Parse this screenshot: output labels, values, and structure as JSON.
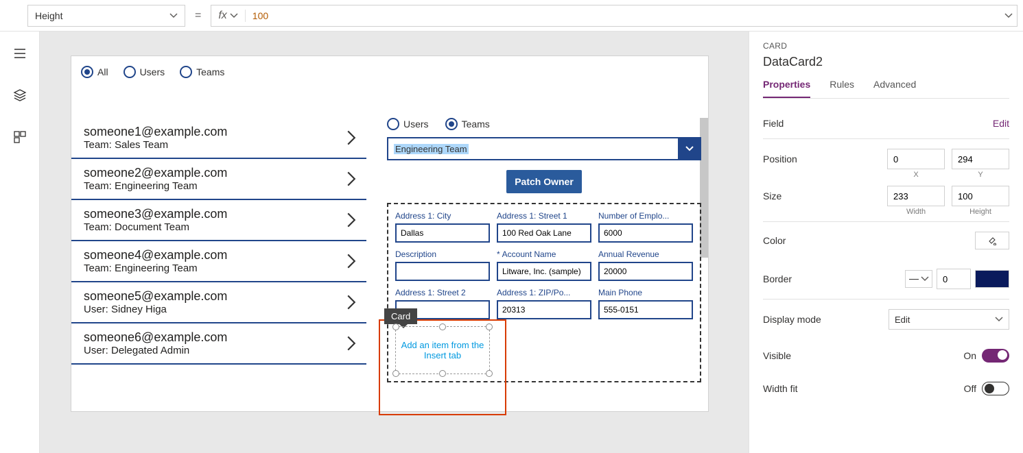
{
  "topbar": {
    "property": "Height",
    "eq": "=",
    "fx_label": "fx",
    "formula": "100"
  },
  "canvas": {
    "filter": {
      "options": [
        "All",
        "Users",
        "Teams"
      ],
      "selected": "All"
    },
    "list": [
      {
        "title": "someone1@example.com",
        "sub": "Team: Sales Team"
      },
      {
        "title": "someone2@example.com",
        "sub": "Team: Engineering Team"
      },
      {
        "title": "someone3@example.com",
        "sub": "Team: Document Team"
      },
      {
        "title": "someone4@example.com",
        "sub": "Team: Engineering Team"
      },
      {
        "title": "someone5@example.com",
        "sub": "User: Sidney Higa"
      },
      {
        "title": "someone6@example.com",
        "sub": "User: Delegated Admin"
      }
    ],
    "owner_filter": {
      "options": [
        "Users",
        "Teams"
      ],
      "selected": "Teams"
    },
    "combo_value": "Engineering Team",
    "patch_button": "Patch Owner",
    "fields": [
      {
        "label": "Address 1: City",
        "value": "Dallas",
        "required": false
      },
      {
        "label": "Address 1: Street 1",
        "value": "100 Red Oak Lane",
        "required": false
      },
      {
        "label": "Number of Emplo...",
        "value": "6000",
        "required": false
      },
      {
        "label": "Description",
        "value": "",
        "required": false
      },
      {
        "label": "Account Name",
        "value": "Litware, Inc. (sample)",
        "required": true
      },
      {
        "label": "Annual Revenue",
        "value": "20000",
        "required": false
      },
      {
        "label": "Address 1: Street 2",
        "value": "",
        "required": false
      },
      {
        "label": "Address 1: ZIP/Po...",
        "value": "20313",
        "required": false
      },
      {
        "label": "Main Phone",
        "value": "555-0151",
        "required": false
      }
    ],
    "selected_card_tag": "Card",
    "empty_card_hint": "Add an item from the Insert tab"
  },
  "panel": {
    "eyebrow": "CARD",
    "title": "DataCard2",
    "tabs": [
      "Properties",
      "Rules",
      "Advanced"
    ],
    "active_tab": "Properties",
    "field_label": "Field",
    "edit_link": "Edit",
    "position_label": "Position",
    "position_x": "0",
    "position_y": "294",
    "x_label": "X",
    "y_label": "Y",
    "size_label": "Size",
    "size_w": "233",
    "size_h": "100",
    "w_label": "Width",
    "h_label": "Height",
    "color_label": "Color",
    "border_label": "Border",
    "border_value": "0",
    "display_mode_label": "Display mode",
    "display_mode_value": "Edit",
    "visible_label": "Visible",
    "visible_value": "On",
    "widthfit_label": "Width fit",
    "widthfit_value": "Off"
  }
}
